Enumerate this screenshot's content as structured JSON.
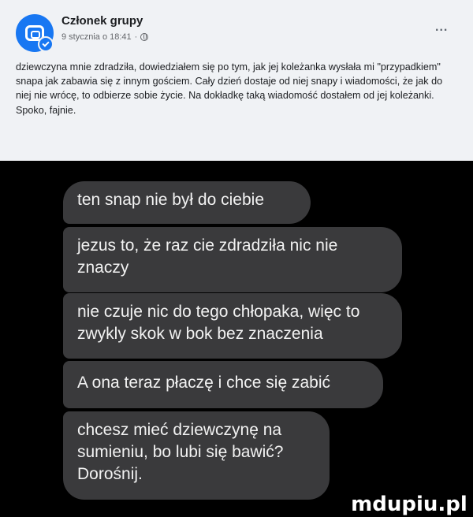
{
  "post": {
    "author": "Członek grupy",
    "timestamp": "9 stycznia o 18:41",
    "privacy_icon": "globe-icon",
    "more_label": "...",
    "text": "dziewczyna mnie zdradziła, dowiedziałem się po tym, jak jej koleżanka wysłała mi \"przypadkiem\" snapa jak zabawia się z innym gościem. Cały dzień dostaje od niej snapy i wiadomości, że jak do niej nie wrócę, to odbierze sobie życie. Na dokładkę taką wiadomość dostałem od jej koleżanki. Spoko, fajnie.",
    "accent": "#1877f2"
  },
  "chat": {
    "messages": [
      "ten snap nie był do ciebie",
      "jezus to, że raz cie zdradziła nic nie znaczy",
      "nie czuje nic do tego chłopaka, więc to zwykly skok w bok bez znaczenia",
      "A ona teraz płaczę i chce się zabić",
      "chcesz mieć dziewczynę na sumieniu, bo lubi się bawić? Dorośnij."
    ],
    "bubble_color": "#3a3a3c"
  },
  "watermark": "mdupiu.pl"
}
